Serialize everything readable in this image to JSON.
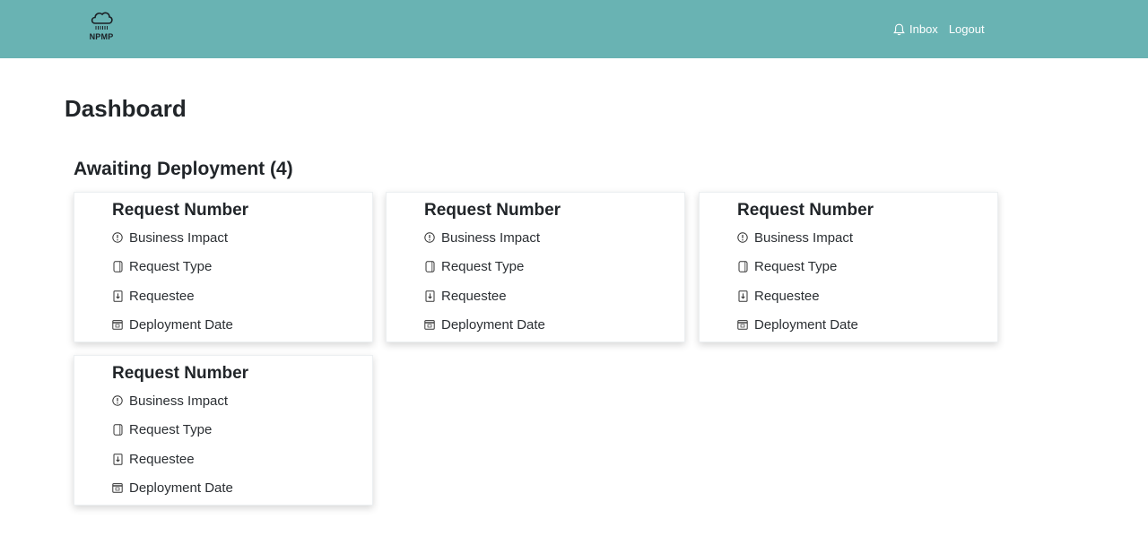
{
  "app": {
    "logo_text": "NPMP"
  },
  "nav": {
    "inbox_label": "Inbox",
    "logout_label": "Logout"
  },
  "page": {
    "title": "Dashboard"
  },
  "section": {
    "title": "Awaiting Deployment (4)"
  },
  "cards": [
    {
      "title": "Request Number",
      "fields": [
        {
          "icon": "exclamation-circle-icon",
          "label": "Business Impact"
        },
        {
          "icon": "document-icon",
          "label": "Request Type"
        },
        {
          "icon": "download-file-icon",
          "label": "Requestee"
        },
        {
          "icon": "calendar-icon",
          "label": "Deployment Date"
        }
      ]
    },
    {
      "title": "Request Number",
      "fields": [
        {
          "icon": "exclamation-circle-icon",
          "label": "Business Impact"
        },
        {
          "icon": "document-icon",
          "label": "Request Type"
        },
        {
          "icon": "download-file-icon",
          "label": "Requestee"
        },
        {
          "icon": "calendar-icon",
          "label": "Deployment Date"
        }
      ]
    },
    {
      "title": "Request Number",
      "fields": [
        {
          "icon": "exclamation-circle-icon",
          "label": "Business Impact"
        },
        {
          "icon": "document-icon",
          "label": "Request Type"
        },
        {
          "icon": "download-file-icon",
          "label": "Requestee"
        },
        {
          "icon": "calendar-icon",
          "label": "Deployment Date"
        }
      ]
    },
    {
      "title": "Request Number",
      "fields": [
        {
          "icon": "exclamation-circle-icon",
          "label": "Business Impact"
        },
        {
          "icon": "document-icon",
          "label": "Request Type"
        },
        {
          "icon": "download-file-icon",
          "label": "Requestee"
        },
        {
          "icon": "calendar-icon",
          "label": "Deployment Date"
        }
      ]
    }
  ],
  "colors": {
    "navbar": "#69b3b3",
    "text": "#212529",
    "card_background": "#ffffff"
  }
}
